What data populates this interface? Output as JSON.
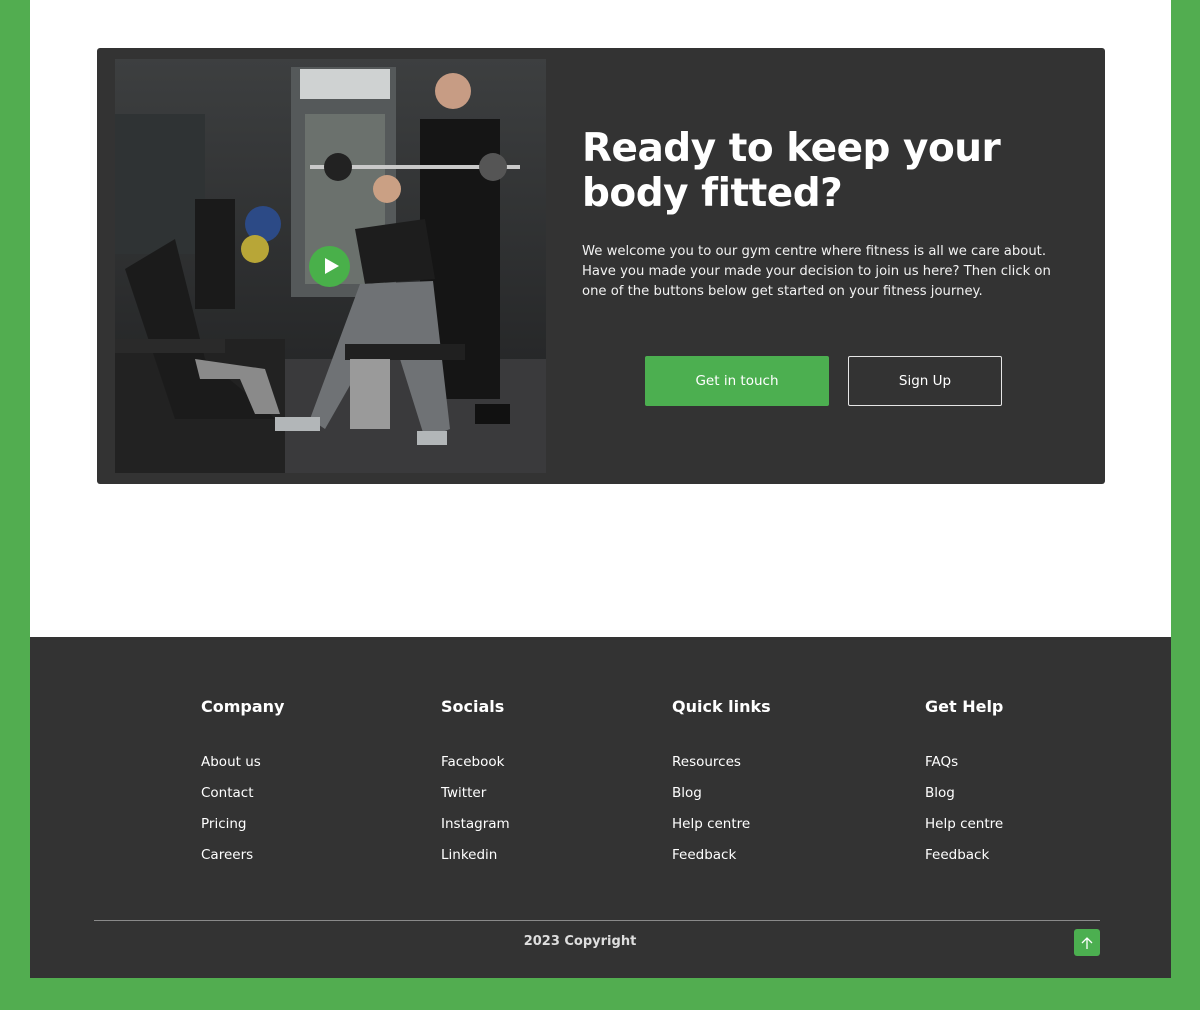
{
  "cta": {
    "title": "Ready to keep your body fitted?",
    "description": "We welcome you to our gym centre where fitness is all we care about. Have you made your made your decision to join us here? Then click on one of the buttons below get started on your fitness journey.",
    "primary_button": "Get in touch",
    "secondary_button": "Sign Up",
    "image_alt": "Trainer assisting woman lifting barbell in gym",
    "play_icon": "play-icon"
  },
  "footer": {
    "columns": [
      {
        "heading": "Company",
        "links": [
          "About us",
          "Contact",
          "Pricing",
          "Careers"
        ]
      },
      {
        "heading": "Socials",
        "links": [
          "Facebook",
          "Twitter",
          "Instagram",
          "Linkedin"
        ]
      },
      {
        "heading": "Quick links",
        "links": [
          "Resources",
          "Blog",
          "Help centre",
          "Feedback"
        ]
      },
      {
        "heading": "Get Help",
        "links": [
          "FAQs",
          "Blog",
          "Help centre",
          "Feedback"
        ]
      }
    ],
    "copyright": "2023 Copyright",
    "back_to_top_icon": "arrow-up-icon"
  },
  "colors": {
    "accent": "#4caf50",
    "frame": "#52ad50",
    "dark": "#333333"
  }
}
